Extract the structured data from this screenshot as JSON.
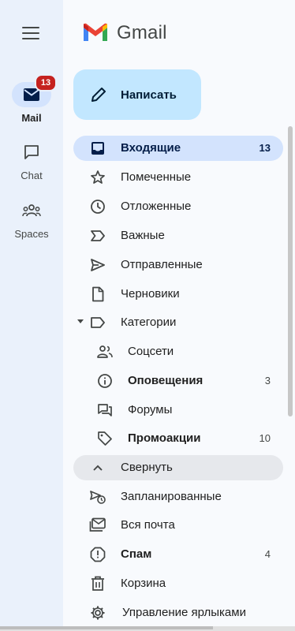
{
  "rail": {
    "items": [
      {
        "label": "Mail",
        "badge": "13",
        "icon": "mail-icon"
      },
      {
        "label": "Chat",
        "icon": "chat-icon"
      },
      {
        "label": "Spaces",
        "icon": "spaces-icon"
      }
    ]
  },
  "header": {
    "logo_text": "Gmail"
  },
  "compose": {
    "label": "Написать"
  },
  "nav": [
    {
      "label": "Входящие",
      "count": "13",
      "icon": "inbox-icon"
    },
    {
      "label": "Помеченные",
      "icon": "star-icon"
    },
    {
      "label": "Отложенные",
      "icon": "clock-icon"
    },
    {
      "label": "Важные",
      "icon": "important-icon"
    },
    {
      "label": "Отправленные",
      "icon": "send-icon"
    },
    {
      "label": "Черновики",
      "icon": "draft-icon"
    },
    {
      "label": "Категории",
      "icon": "label-icon"
    },
    {
      "label": "Соцсети",
      "icon": "people-icon"
    },
    {
      "label": "Оповещения",
      "count": "3",
      "icon": "info-icon"
    },
    {
      "label": "Форумы",
      "icon": "forum-icon"
    },
    {
      "label": "Промоакции",
      "count": "10",
      "icon": "tag-icon"
    },
    {
      "label": "Свернуть",
      "icon": "chevron-up-icon"
    },
    {
      "label": "Запланированные",
      "icon": "scheduled-icon"
    },
    {
      "label": "Вся почта",
      "icon": "all-mail-icon"
    },
    {
      "label": "Спам",
      "count": "4",
      "icon": "spam-icon"
    },
    {
      "label": "Корзина",
      "icon": "trash-icon"
    },
    {
      "label": "Управление ярлыками",
      "icon": "settings-icon"
    }
  ],
  "colors": {
    "accent": "#d3e3fd",
    "compose_bg": "#c2e7ff",
    "badge": "#c5221f",
    "rail_bg": "#eaf1fb"
  }
}
